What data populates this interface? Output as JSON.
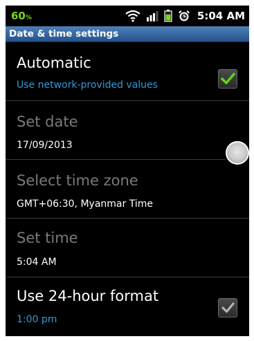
{
  "status_bar": {
    "battery_percent": "60",
    "battery_percent_suffix": "%",
    "time": "5:04 AM",
    "icons": [
      "wifi-icon",
      "signal-icon",
      "battery-icon",
      "alarm-icon"
    ],
    "battery_color": "#7cd321"
  },
  "title_bar": {
    "title": "Date & time settings"
  },
  "settings": {
    "automatic": {
      "title": "Automatic",
      "summary": "Use network-provided values",
      "checked": true
    },
    "set_date": {
      "title": "Set date",
      "summary": "17/09/2013"
    },
    "time_zone": {
      "title": "Select time zone",
      "summary": "GMT+06:30, Myanmar Time"
    },
    "set_time": {
      "title": "Set time",
      "summary": "5:04 AM"
    },
    "hour_format": {
      "title": "Use 24-hour format",
      "summary": "1:00 pm",
      "checked": true
    }
  },
  "colors": {
    "accent_blue": "#2e9bd9",
    "check_green": "#5fd418",
    "disabled_text": "#7a7a7a"
  }
}
